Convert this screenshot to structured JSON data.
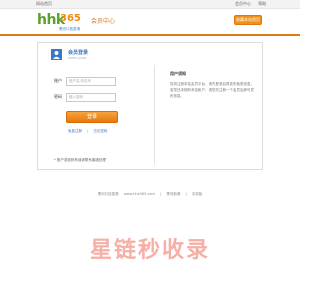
{
  "topbar": {
    "left_text": "网站首页",
    "right_items": [
      "会员中心",
      "帮助"
    ]
  },
  "logo": {
    "hh": "hhk",
    "num": "365",
    "sub": "黑河口信息港"
  },
  "header": {
    "title": "会员中心",
    "fav_button": "收藏本站首页"
  },
  "login": {
    "title": "会员登录",
    "subtitle": "USER LOGIN",
    "account_label": "账户",
    "account_placeholder": "用户名/手机号",
    "password_label": "密码",
    "password_placeholder": "输入密码",
    "submit_label": "登录",
    "register_link": "免费注册",
    "forgot_link": "忘记密码",
    "tip": "* 账户或密码有误请联系客服处理"
  },
  "side": {
    "title": "用户须知",
    "text": "您将注册本站会员平台，请先登录后再发布各类信息，若您还未拥有本站帐户，请您先注册一个会员后即可发布信息。"
  },
  "footer": {
    "items": [
      "黑河口信息港",
      "www.hhk365.com",
      "黑河新闻",
      "手机版"
    ]
  },
  "watermark": "星链秒收录"
}
